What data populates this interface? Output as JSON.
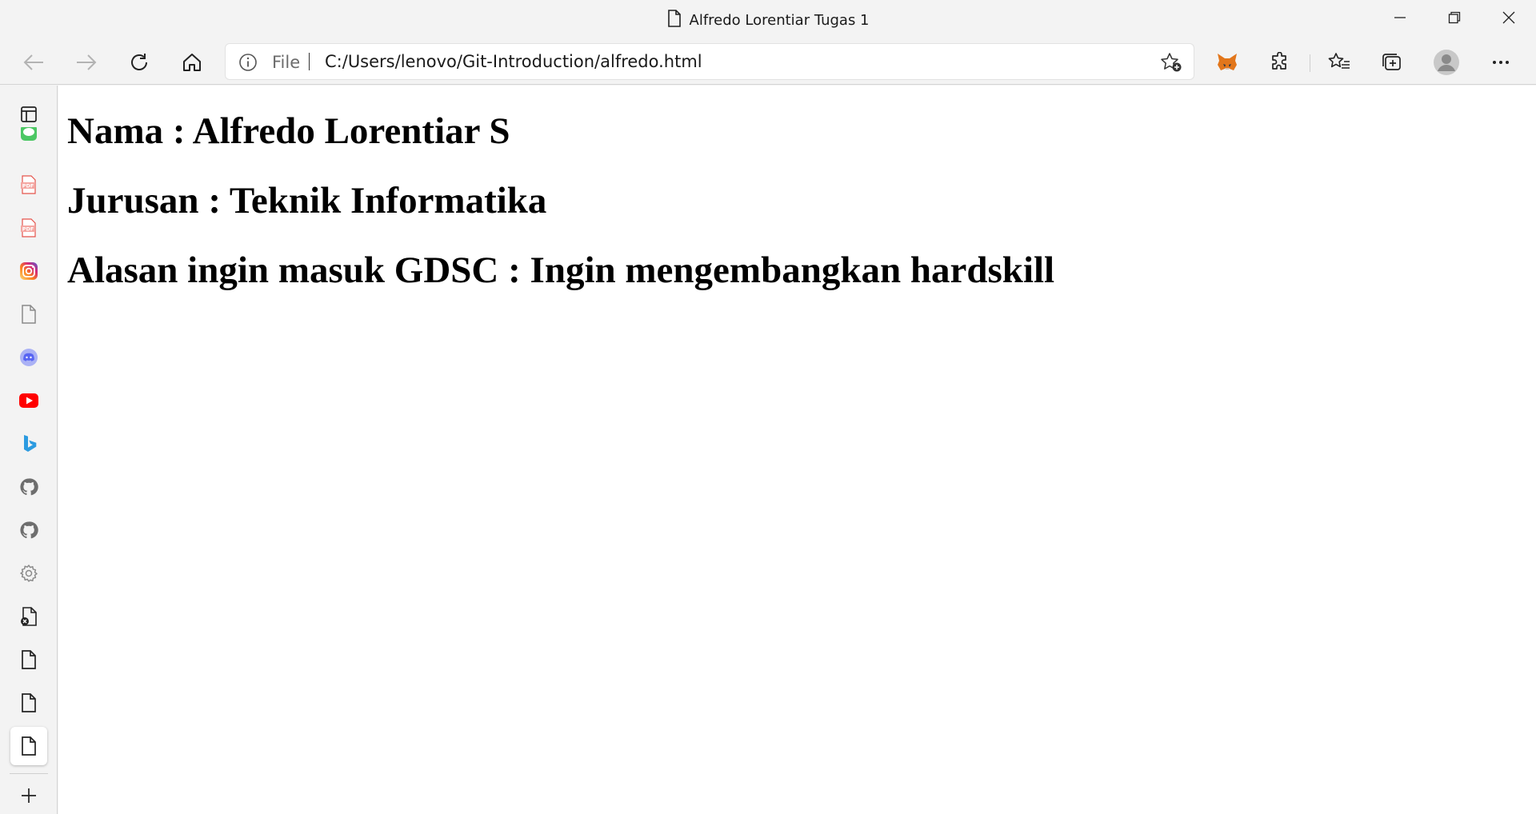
{
  "window": {
    "title": "Alfredo Lorentiar Tugas 1"
  },
  "toolbar": {
    "address_protocol": "File",
    "address_url": "C:/Users/lenovo/Git-Introduction/alfredo.html"
  },
  "sidebar": {
    "items": [
      {
        "icon": "tab-actions-icon"
      },
      {
        "icon": "line-app-icon",
        "color": "#4cc764"
      },
      {
        "icon": "pdf-file-icon",
        "color": "#e5534b"
      },
      {
        "icon": "pdf-file-icon",
        "color": "#e5534b"
      },
      {
        "icon": "instagram-icon",
        "color": "#d6249f"
      },
      {
        "icon": "document-icon"
      },
      {
        "icon": "discord-icon",
        "color": "#5865f2"
      },
      {
        "icon": "youtube-icon",
        "color": "#ff0000"
      },
      {
        "icon": "bing-icon",
        "color": "#2c9be0"
      },
      {
        "icon": "github-icon"
      },
      {
        "icon": "github-icon"
      },
      {
        "icon": "settings-gear-icon"
      },
      {
        "icon": "document-error-icon"
      },
      {
        "icon": "document-icon"
      },
      {
        "icon": "document-icon"
      },
      {
        "icon": "document-icon",
        "active": true
      },
      {
        "icon": "new-tab-plus-icon"
      }
    ]
  },
  "page": {
    "line1": "Nama : Alfredo Lorentiar S",
    "line2": "Jurusan : Teknik Informatika",
    "line3": "Alasan ingin masuk GDSC : Ingin mengembangkan hardskill"
  }
}
